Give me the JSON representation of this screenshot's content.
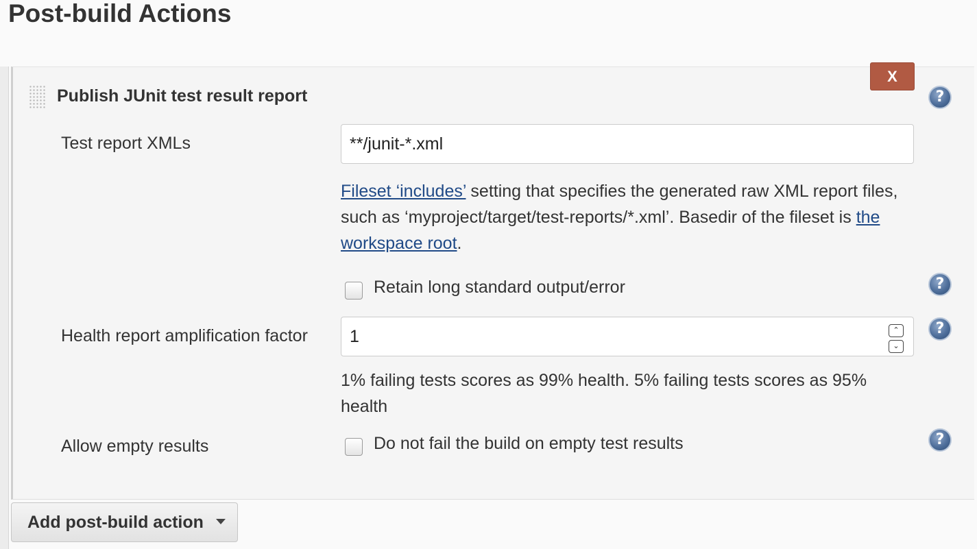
{
  "section": {
    "title": "Post-build Actions"
  },
  "action": {
    "title": "Publish JUnit test result report",
    "delete_label": "X",
    "help_glyph": "?"
  },
  "fields": {
    "test_report_xmls": {
      "label": "Test report XMLs",
      "value": "**/junit-*.xml",
      "help": {
        "link1": "Fileset ‘includes’",
        "text1": " setting that specifies the generated raw XML report files, such as ‘myproject/target/test-reports/*.xml’. Basedir of the fileset is ",
        "link2": "the workspace root",
        "text2": "."
      }
    },
    "retain_output": {
      "label": "Retain long standard output/error",
      "checked": false
    },
    "health_factor": {
      "label": "Health report amplification factor",
      "value": "1",
      "help": "1% failing tests scores as 99% health. 5% failing tests scores as 95% health"
    },
    "allow_empty": {
      "label": "Allow empty results",
      "checkbox_label": "Do not fail the build on empty test results",
      "checked": false
    }
  },
  "footer": {
    "add_action_label": "Add post-build action"
  },
  "icons": {
    "help": "help-icon",
    "drag": "drag-handle-icon",
    "dropdown": "caret-down-icon",
    "spinner_up": "chevron-up-icon",
    "spinner_down": "chevron-down-icon"
  },
  "colors": {
    "delete_button": "#b15a43",
    "link": "#204a87",
    "help_icon": "#4f6f9b"
  }
}
